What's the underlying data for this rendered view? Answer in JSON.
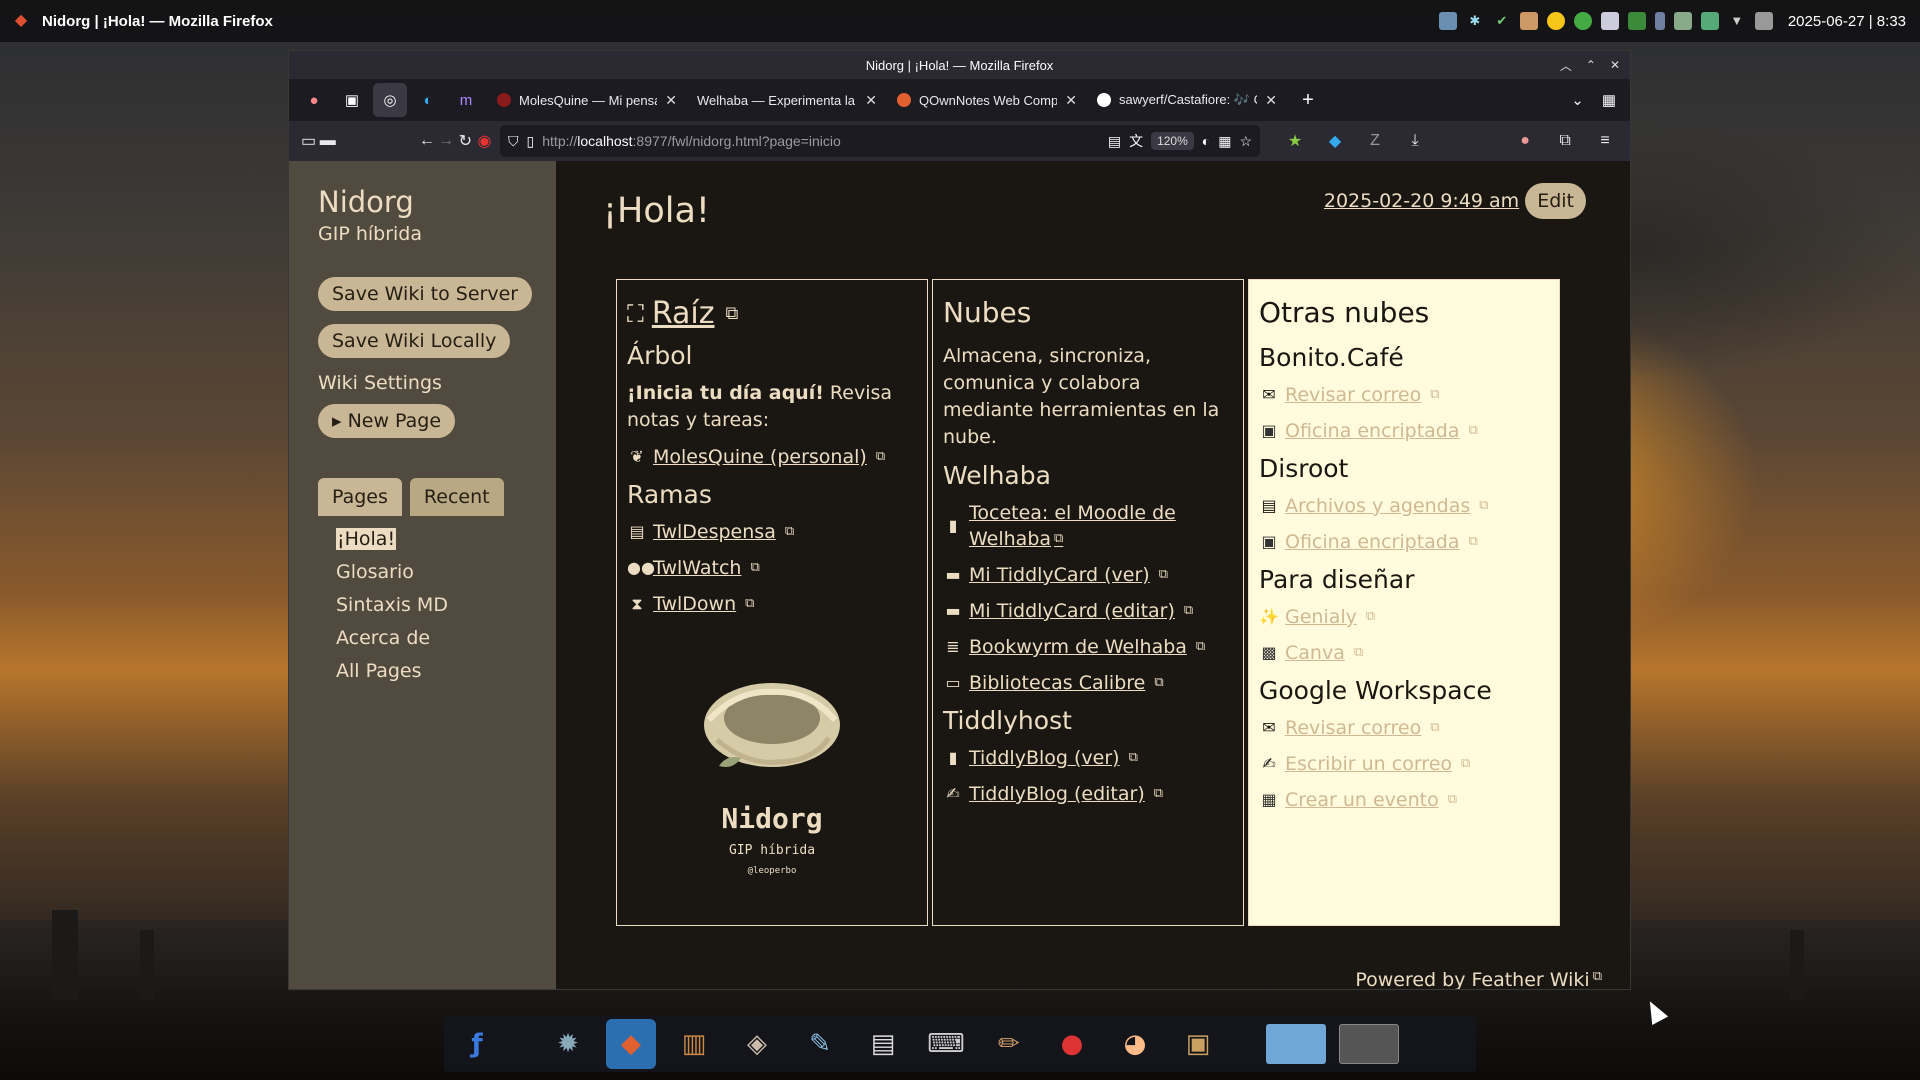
{
  "topbar": {
    "window_title": "Nidorg | ¡Hola! — Mozilla Firefox",
    "clock": "2025-06-27 | 8:33"
  },
  "browser": {
    "title": "Nidorg | ¡Hola! — Mozilla Firefox",
    "tabs": [
      {
        "label": "MolesQuine — Mi pensadero",
        "color": "#8b1a1a"
      },
      {
        "label": "Welhaba — Experimenta la lectura",
        "color": "#444444"
      },
      {
        "label": "QOwnNotes Web Companion",
        "color": "#e06030"
      },
      {
        "label": "sawyerf/Castafiore: 🎶 Castafiore",
        "color": "#ffffff"
      }
    ],
    "url_prefix": "http://",
    "url_host": "localhost",
    "url_rest": ":8977/fwl/nidorg.html?page=inicio",
    "zoom": "120%"
  },
  "sidebar": {
    "title": "Nidorg",
    "subtitle": "GIP híbrida",
    "save_server": "Save Wiki to Server",
    "save_local": "Save Wiki Locally",
    "settings": "Wiki Settings",
    "new_page": "▸ New Page",
    "tab_pages": "Pages",
    "tab_recent": "Recent",
    "pages": [
      "¡Hola!",
      "Glosario",
      "Sintaxis MD",
      "Acerca de",
      "All Pages"
    ]
  },
  "main": {
    "heading": "¡Hola!",
    "date": "2025-02-20 9:49 am",
    "edit": "Edit",
    "footer": "Powered by Feather Wiki"
  },
  "col1": {
    "title": "Raíz",
    "arbol": "Árbol",
    "intro_bold": "¡Inicia tu día aquí!",
    "intro_rest": " Revisa notas y tareas:",
    "molesquine": "MolesQuine (personal)",
    "ramas": "Ramas",
    "links": [
      "TwlDespensa",
      "TwlWatch",
      "TwlDown"
    ],
    "nest_name": "Nidorg",
    "nest_sub": "GIP híbrida",
    "nest_handle": "@leoperbo"
  },
  "col2": {
    "title": "Nubes",
    "desc": "Almacena, sincroniza, comunica y colabora mediante herramientas en la nube.",
    "welhaba": "Welhaba",
    "welhaba_links": [
      "Tocetea: el Moodle de Welhaba",
      "Mi TiddlyCard (ver)",
      "Mi TiddlyCard (editar)",
      "Bookwyrm de Welhaba",
      "Bibliotecas Calibre"
    ],
    "tiddlyhost": "Tiddlyhost",
    "tiddly_links": [
      "TiddlyBlog (ver)",
      "TiddlyBlog (editar)"
    ]
  },
  "col3": {
    "title": "Otras nubes",
    "bonito": "Bonito.Café",
    "bonito_links": [
      "Revisar correo",
      "Oficina encriptada"
    ],
    "disroot": "Disroot",
    "disroot_links": [
      "Archivos y agendas",
      "Oficina encriptada"
    ],
    "disenar": "Para diseñar",
    "disenar_links": [
      "Genialy",
      "Canva"
    ],
    "google": "Google Workspace",
    "google_links": [
      "Revisar correo",
      "Escribir un correo",
      "Crear un evento"
    ]
  }
}
